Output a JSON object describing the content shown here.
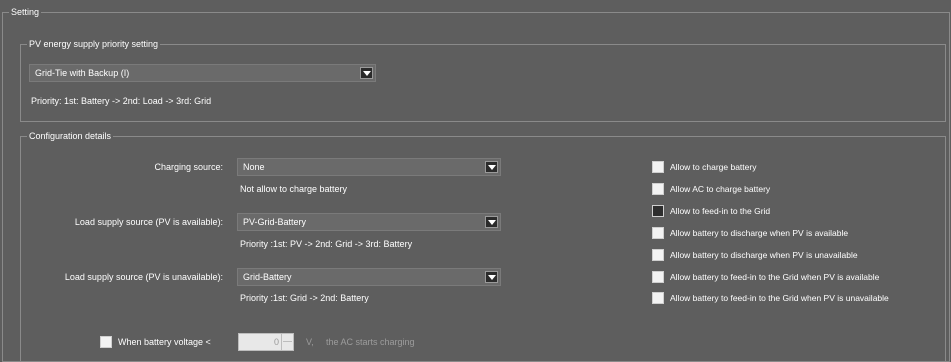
{
  "setting": {
    "legend": "Setting"
  },
  "pv_priority": {
    "legend": "PV energy supply priority setting",
    "selected": "Grid-Tie with Backup (I)",
    "priority_text": "Priority: 1st: Battery -> 2nd: Load -> 3rd: Grid"
  },
  "config": {
    "legend": "Configuration details",
    "charging_source": {
      "label": "Charging source:",
      "selected": "None",
      "note": "Not allow to charge battery"
    },
    "load_pv_available": {
      "label": "Load supply source (PV is available):",
      "selected": "PV-Grid-Battery",
      "note": "Priority :1st: PV -> 2nd: Grid -> 3rd: Battery"
    },
    "load_pv_unavailable": {
      "label": "Load supply source (PV is unavailable):",
      "selected": "Grid-Battery",
      "note": "Priority :1st: Grid -> 2nd: Battery"
    },
    "battery_voltage": {
      "label": "When battery voltage <",
      "value": "0",
      "unit": "V,",
      "suffix": "the AC starts charging"
    },
    "options": [
      {
        "label": "Allow to charge battery",
        "checked": false
      },
      {
        "label": "Allow AC to charge battery",
        "checked": false
      },
      {
        "label": "Allow to feed-in to the Grid",
        "checked": false
      },
      {
        "label": "Allow battery to discharge when PV is available",
        "checked": false
      },
      {
        "label": "Allow battery to discharge when PV is unavailable",
        "checked": false
      },
      {
        "label": "Allow battery to feed-in to the Grid when PV is available",
        "checked": false
      },
      {
        "label": "Allow battery to feed-in to the Grid when PV is unavailable",
        "checked": false
      }
    ]
  }
}
